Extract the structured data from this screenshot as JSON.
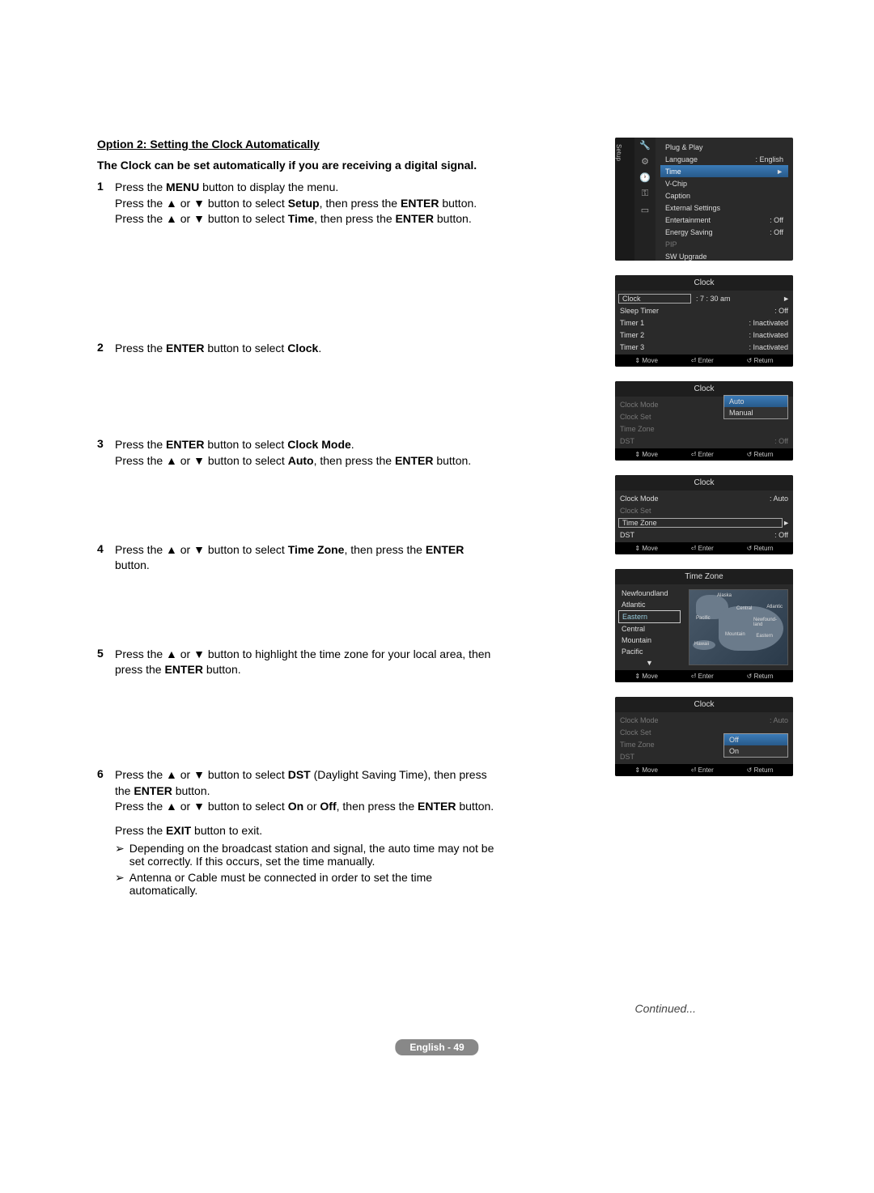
{
  "heading": "Option 2: Setting the Clock Automatically",
  "intro": "The Clock can be set automatically if you are receiving a digital signal.",
  "steps": {
    "s1a": "Press the ",
    "s1a_b": "MENU",
    "s1a_c": " button to display the menu.",
    "s1b": "Press the ▲ or ▼ button to select ",
    "s1b_b": "Setup",
    "s1b_c": ", then press the ",
    "s1b_d": "ENTER",
    "s1b_e": " button.",
    "s1c": "Press the ▲ or ▼ button to select ",
    "s1c_b": "Time",
    "s1c_c": ", then press the ",
    "s1c_d": "ENTER",
    "s1c_e": " button.",
    "s2a": "Press the ",
    "s2a_b": "ENTER",
    "s2a_c": " button to select ",
    "s2a_d": "Clock",
    "s2a_e": ".",
    "s3a": "Press the ",
    "s3a_b": "ENTER",
    "s3a_c": " button to select ",
    "s3a_d": "Clock Mode",
    "s3a_e": ".",
    "s3b": "Press the ▲ or ▼ button to select ",
    "s3b_b": "Auto",
    "s3b_c": ", then press the ",
    "s3b_d": "ENTER",
    "s3b_e": " button.",
    "s4a": "Press the ▲ or ▼ button to select ",
    "s4a_b": "Time Zone",
    "s4a_c": ", then press the ",
    "s4a_d": "ENTER",
    "s4a_e": " button.",
    "s5a": "Press the ▲ or ▼ button to highlight the time zone for your local area, then press the ",
    "s5a_b": "ENTER",
    "s5a_c": " button.",
    "s6a": "Press the ▲ or ▼ button to select ",
    "s6a_b": "DST",
    "s6a_c": " (Daylight Saving Time), then press the ",
    "s6a_d": "ENTER",
    "s6a_e": " button.",
    "s6b": "Press the ▲ or ▼ button to select ",
    "s6b_b": "On",
    "s6b_c": " or ",
    "s6b_d": "Off",
    "s6b_e": ", then press the ",
    "s6b_f": "ENTER",
    "s6b_g": " button.",
    "s6c": "Press the ",
    "s6c_b": "EXIT",
    "s6c_c": " button to exit.",
    "note1": "Depending on the broadcast station and signal, the auto time may not be set correctly. If this occurs, set the time manually.",
    "note2": "Antenna or Cable must be connected in order to set the time automatically."
  },
  "arrow": "➢",
  "continued": "Continued...",
  "pagenum": "English - 49",
  "nums": {
    "n1": "1",
    "n2": "2",
    "n3": "3",
    "n4": "4",
    "n5": "5",
    "n6": "6"
  },
  "osd1": {
    "tab": "Setup",
    "items": {
      "plugplay": "Plug & Play",
      "language": "Language",
      "language_v": ": English",
      "time": "Time",
      "vchip": "V-Chip",
      "caption": "Caption",
      "ext": "External Settings",
      "ent": "Entertainment",
      "ent_v": ": Off",
      "energy": "Energy Saving",
      "energy_v": ": Off",
      "pip": "PIP",
      "sw": "SW Upgrade"
    }
  },
  "osd2": {
    "title": "Clock",
    "rows": {
      "clock": "Clock",
      "clock_v": ":  7 : 30 am",
      "sleep": "Sleep Timer",
      "sleep_v": ": Off",
      "t1": "Timer 1",
      "t1_v": ": Inactivated",
      "t2": "Timer 2",
      "t2_v": ": Inactivated",
      "t3": "Timer 3",
      "t3_v": ": Inactivated"
    }
  },
  "osd3": {
    "title": "Clock",
    "rows": {
      "mode": "Clock Mode",
      "mode_v": ":",
      "set": "Clock Set",
      "tz": "Time Zone",
      "dst": "DST",
      "dst_v": ": Off"
    },
    "popup": {
      "auto": "Auto",
      "manual": "Manual"
    }
  },
  "osd4": {
    "title": "Clock",
    "rows": {
      "mode": "Clock Mode",
      "mode_v": ": Auto",
      "set": "Clock Set",
      "tz": "Time Zone",
      "dst": "DST",
      "dst_v": ": Off"
    }
  },
  "osd5": {
    "title": "Time Zone",
    "zones": {
      "nf": "Newfoundland",
      "atl": "Atlantic",
      "east": "Eastern",
      "cen": "Central",
      "mtn": "Mountain",
      "pac": "Pacific"
    },
    "maplabels": {
      "alaska": "Alaska",
      "pacific": "Pacific",
      "central": "Central",
      "atlantic": "Atlantic",
      "newfoundland": "Newfound-land",
      "mountain": "Mountain",
      "eastern": "Eastern",
      "hawaii": "Hawaii"
    },
    "scroll": "▼"
  },
  "osd6": {
    "title": "Clock",
    "rows": {
      "mode": "Clock Mode",
      "mode_v": ": Auto",
      "set": "Clock Set",
      "tz": "Time Zone",
      "dst": "DST"
    },
    "popup": {
      "off": "Off",
      "on": "On"
    }
  },
  "footer": {
    "move": "Move",
    "enter": "Enter",
    "return": "Return"
  },
  "caret": "►",
  "updown": "⇕",
  "enterglyph": "⏎",
  "returnglyph": "↺"
}
